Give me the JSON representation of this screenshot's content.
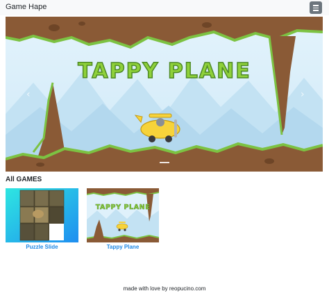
{
  "navbar": {
    "brand": "Game Hape",
    "menu_icon": "hamburger-icon"
  },
  "carousel": {
    "slide_title": "TAPPY PLANE",
    "prev_icon": "chevron-left-icon",
    "next_icon": "chevron-right-icon"
  },
  "games_section": {
    "heading": "All GAMES",
    "games": [
      {
        "name": "Puzzle Slide"
      },
      {
        "name": "Tappy Plane"
      }
    ]
  },
  "footer": {
    "text": "made with love by reopucino.com"
  },
  "colors": {
    "navbar_bg": "#f8f9fa",
    "link": "#1e88e5",
    "sky": "#dff1fb",
    "dirt": "#8a5a36",
    "grass": "#7cc242",
    "title_fill": "#8fd13a",
    "plane": "#f7d33a"
  }
}
